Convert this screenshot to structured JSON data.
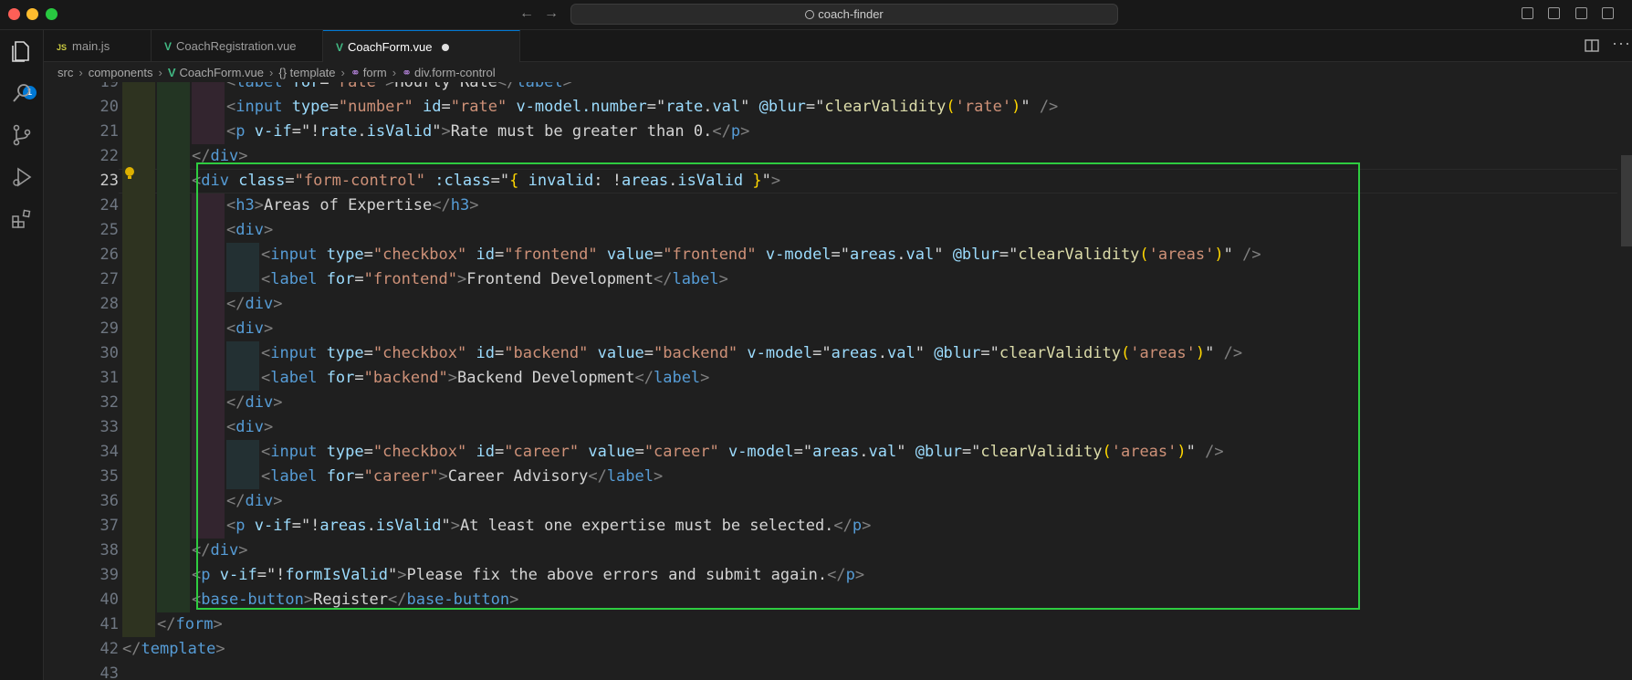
{
  "window": {
    "search_text": "coach-finder"
  },
  "activity": {
    "badge": "1"
  },
  "tabs": [
    {
      "label": "main.js",
      "kind": "js",
      "active": false
    },
    {
      "label": "CoachRegistration.vue",
      "kind": "vue",
      "active": false
    },
    {
      "label": "CoachForm.vue",
      "kind": "vue",
      "active": true,
      "modified": true
    }
  ],
  "breadcrumbs": [
    "src",
    "components",
    "CoachForm.vue",
    "{} template",
    "form",
    "div.form-control"
  ],
  "editor": {
    "active_line": "23",
    "lines": [
      {
        "n": "19",
        "html": "<span class='p'>&lt;</span><span class='t'>label</span> <span class='a'>for</span><span class='x'>=</span><span class='s'>\"rate\"</span><span class='p'>&gt;</span><span class='x'>Hourly Rate</span><span class='p'>&lt;/</span><span class='t'>label</span><span class='p'>&gt;</span>",
        "indent": 2
      },
      {
        "n": "20",
        "html": "<span class='p'>&lt;</span><span class='t'>input</span> <span class='a'>type</span><span class='x'>=</span><span class='s'>\"number\"</span> <span class='a'>id</span><span class='x'>=</span><span class='s'>\"rate\"</span> <span class='a'>v-model.number</span><span class='x'>=</span><span class='x'>\"</span><span class='a'>rate</span><span class='x'>.</span><span class='a'>val</span><span class='x'>\"</span> <span class='a'>@blur</span><span class='x'>=\"</span><span class='f'>clearValidity</span><span class='y'>(</span><span class='s'>'rate'</span><span class='y'>)</span><span class='x'>\"</span> <span class='p'>/&gt;</span>",
        "indent": 2
      },
      {
        "n": "21",
        "html": "<span class='p'>&lt;</span><span class='t'>p</span> <span class='a'>v-if</span><span class='x'>=\"!</span><span class='a'>rate</span><span class='x'>.</span><span class='a'>isValid</span><span class='x'>\"</span><span class='p'>&gt;</span><span class='x'>Rate must be greater than 0.</span><span class='p'>&lt;/</span><span class='t'>p</span><span class='p'>&gt;</span>",
        "indent": 2
      },
      {
        "n": "22",
        "html": "<span class='p'>&lt;/</span><span class='t'>div</span><span class='p'>&gt;</span>",
        "indent": 1
      },
      {
        "n": "23",
        "html": "<span class='p'>&lt;</span><span class='t'>div</span> <span class='a'>class</span><span class='x'>=</span><span class='s'>\"form-control\"</span> <span class='a'>:class</span><span class='x'>=\"</span><span class='y'>{</span> <span class='a'>invalid</span><span class='x'>: !</span><span class='a'>areas</span><span class='x'>.</span><span class='a'>isValid</span> <span class='y'>}</span><span class='x'>\"</span><span class='p'>&gt;</span>",
        "indent": 1
      },
      {
        "n": "24",
        "html": "<span class='p'>&lt;</span><span class='t'>h3</span><span class='p'>&gt;</span><span class='x'>Areas of Expertise</span><span class='p'>&lt;/</span><span class='t'>h3</span><span class='p'>&gt;</span>",
        "indent": 2
      },
      {
        "n": "25",
        "html": "<span class='p'>&lt;</span><span class='t'>div</span><span class='p'>&gt;</span>",
        "indent": 2
      },
      {
        "n": "26",
        "html": "<span class='p'>&lt;</span><span class='t'>input</span> <span class='a'>type</span><span class='x'>=</span><span class='s'>\"checkbox\"</span> <span class='a'>id</span><span class='x'>=</span><span class='s'>\"frontend\"</span> <span class='a'>value</span><span class='x'>=</span><span class='s'>\"frontend\"</span> <span class='a'>v-model</span><span class='x'>=\"</span><span class='a'>areas</span><span class='x'>.</span><span class='a'>val</span><span class='x'>\"</span> <span class='a'>@blur</span><span class='x'>=\"</span><span class='f'>clearValidity</span><span class='y'>(</span><span class='s'>'areas'</span><span class='y'>)</span><span class='x'>\"</span> <span class='p'>/&gt;</span>",
        "indent": 3
      },
      {
        "n": "27",
        "html": "<span class='p'>&lt;</span><span class='t'>label</span> <span class='a'>for</span><span class='x'>=</span><span class='s'>\"frontend\"</span><span class='p'>&gt;</span><span class='x'>Frontend Development</span><span class='p'>&lt;/</span><span class='t'>label</span><span class='p'>&gt;</span>",
        "indent": 3
      },
      {
        "n": "28",
        "html": "<span class='p'>&lt;/</span><span class='t'>div</span><span class='p'>&gt;</span>",
        "indent": 2
      },
      {
        "n": "29",
        "html": "<span class='p'>&lt;</span><span class='t'>div</span><span class='p'>&gt;</span>",
        "indent": 2
      },
      {
        "n": "30",
        "html": "<span class='p'>&lt;</span><span class='t'>input</span> <span class='a'>type</span><span class='x'>=</span><span class='s'>\"checkbox\"</span> <span class='a'>id</span><span class='x'>=</span><span class='s'>\"backend\"</span> <span class='a'>value</span><span class='x'>=</span><span class='s'>\"backend\"</span> <span class='a'>v-model</span><span class='x'>=\"</span><span class='a'>areas</span><span class='x'>.</span><span class='a'>val</span><span class='x'>\"</span> <span class='a'>@blur</span><span class='x'>=\"</span><span class='f'>clearValidity</span><span class='y'>(</span><span class='s'>'areas'</span><span class='y'>)</span><span class='x'>\"</span> <span class='p'>/&gt;</span>",
        "indent": 3
      },
      {
        "n": "31",
        "html": "<span class='p'>&lt;</span><span class='t'>label</span> <span class='a'>for</span><span class='x'>=</span><span class='s'>\"backend\"</span><span class='p'>&gt;</span><span class='x'>Backend Development</span><span class='p'>&lt;/</span><span class='t'>label</span><span class='p'>&gt;</span>",
        "indent": 3
      },
      {
        "n": "32",
        "html": "<span class='p'>&lt;/</span><span class='t'>div</span><span class='p'>&gt;</span>",
        "indent": 2
      },
      {
        "n": "33",
        "html": "<span class='p'>&lt;</span><span class='t'>div</span><span class='p'>&gt;</span>",
        "indent": 2
      },
      {
        "n": "34",
        "html": "<span class='p'>&lt;</span><span class='t'>input</span> <span class='a'>type</span><span class='x'>=</span><span class='s'>\"checkbox\"</span> <span class='a'>id</span><span class='x'>=</span><span class='s'>\"career\"</span> <span class='a'>value</span><span class='x'>=</span><span class='s'>\"career\"</span> <span class='a'>v-model</span><span class='x'>=\"</span><span class='a'>areas</span><span class='x'>.</span><span class='a'>val</span><span class='x'>\"</span> <span class='a'>@blur</span><span class='x'>=\"</span><span class='f'>clearValidity</span><span class='y'>(</span><span class='s'>'areas'</span><span class='y'>)</span><span class='x'>\"</span> <span class='p'>/&gt;</span>",
        "indent": 3
      },
      {
        "n": "35",
        "html": "<span class='p'>&lt;</span><span class='t'>label</span> <span class='a'>for</span><span class='x'>=</span><span class='s'>\"career\"</span><span class='p'>&gt;</span><span class='x'>Career Advisory</span><span class='p'>&lt;/</span><span class='t'>label</span><span class='p'>&gt;</span>",
        "indent": 3
      },
      {
        "n": "36",
        "html": "<span class='p'>&lt;/</span><span class='t'>div</span><span class='p'>&gt;</span>",
        "indent": 2
      },
      {
        "n": "37",
        "html": "<span class='p'>&lt;</span><span class='t'>p</span> <span class='a'>v-if</span><span class='x'>=\"!</span><span class='a'>areas</span><span class='x'>.</span><span class='a'>isValid</span><span class='x'>\"</span><span class='p'>&gt;</span><span class='x'>At least one expertise must be selected.</span><span class='p'>&lt;/</span><span class='t'>p</span><span class='p'>&gt;</span>",
        "indent": 2
      },
      {
        "n": "38",
        "html": "<span class='p'>&lt;/</span><span class='t'>div</span><span class='p'>&gt;</span>",
        "indent": 1
      },
      {
        "n": "39",
        "html": "<span class='p'>&lt;</span><span class='t'>p</span> <span class='a'>v-if</span><span class='x'>=\"!</span><span class='a'>formIsValid</span><span class='x'>\"</span><span class='p'>&gt;</span><span class='x'>Please fix the above errors and submit again.</span><span class='p'>&lt;/</span><span class='t'>p</span><span class='p'>&gt;</span>",
        "indent": 1
      },
      {
        "n": "40",
        "html": "<span class='p'>&lt;</span><span class='t'>base-button</span><span class='p'>&gt;</span><span class='x'>Register</span><span class='p'>&lt;/</span><span class='t'>base-button</span><span class='p'>&gt;</span>",
        "indent": 1
      },
      {
        "n": "41",
        "html": "<span class='p'>&lt;/</span><span class='t'>form</span><span class='p'>&gt;</span>",
        "indent": 0
      },
      {
        "n": "42",
        "html": "<span class='p'>&lt;/</span><span class='t'>template</span><span class='p'>&gt;</span>",
        "indent": -1
      },
      {
        "n": "43",
        "html": "",
        "indent": -1
      }
    ]
  },
  "colors": {
    "accent": "#0078d4",
    "selection_box": "#2ecc40"
  }
}
